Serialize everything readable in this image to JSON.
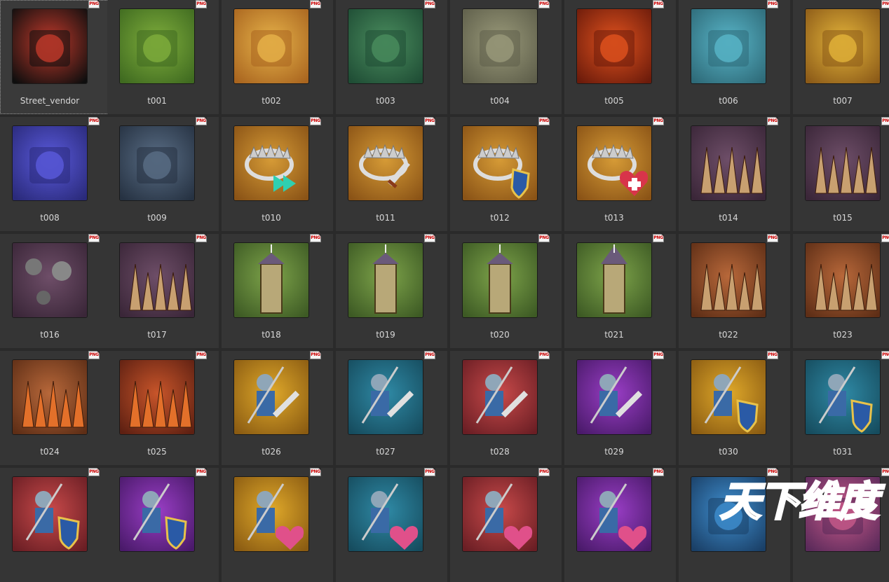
{
  "file_badge": "PNG",
  "items": [
    {
      "name": "Street_vendor",
      "icon": "street-vendor-icon",
      "bg": "#c0392b",
      "bg2": "#0e0e0e",
      "selected": true
    },
    {
      "name": "t001",
      "icon": "backpack-icon",
      "bg": "#7fae3c",
      "bg2": "#3f6a20"
    },
    {
      "name": "t002",
      "icon": "wheat-icon",
      "bg": "#e7b34a",
      "bg2": "#a9651f"
    },
    {
      "name": "t003",
      "icon": "lumber-axe-icon",
      "bg": "#4a8d5e",
      "bg2": "#1f4d35"
    },
    {
      "name": "t004",
      "icon": "stone-blocks-icon",
      "bg": "#9a9a7a",
      "bg2": "#5e5e4a"
    },
    {
      "name": "t005",
      "icon": "iron-lava-icon",
      "bg": "#e1521e",
      "bg2": "#6b1b0b"
    },
    {
      "name": "t006",
      "icon": "crane-construction-icon",
      "bg": "#59b6c9",
      "bg2": "#2e6a78"
    },
    {
      "name": "t007",
      "icon": "hammer-stone-icon",
      "bg": "#e4b43a",
      "bg2": "#8b5a18"
    },
    {
      "name": "t008",
      "icon": "crystal-miner-icon",
      "bg": "#5a5adc",
      "bg2": "#2a2a7a"
    },
    {
      "name": "t009",
      "icon": "storage-crate-icon",
      "bg": "#5a6e86",
      "bg2": "#263242"
    },
    {
      "name": "t010",
      "icon": "trap-speed-icon",
      "bg": "#d69b36",
      "bg2": "#8a5316"
    },
    {
      "name": "t011",
      "icon": "trap-sword-icon",
      "bg": "#d69b36",
      "bg2": "#8a5316"
    },
    {
      "name": "t012",
      "icon": "trap-shield-icon",
      "bg": "#d69b36",
      "bg2": "#8a5316"
    },
    {
      "name": "t013",
      "icon": "trap-heal-icon",
      "bg": "#d69b36",
      "bg2": "#8a5316"
    },
    {
      "name": "t014",
      "icon": "spiked-balls-icon",
      "bg": "#6e4e68",
      "bg2": "#3a2638"
    },
    {
      "name": "t015",
      "icon": "spiked-logs-icon",
      "bg": "#6e4e68",
      "bg2": "#3a2638"
    },
    {
      "name": "t016",
      "icon": "fire-caltrops-icon",
      "bg": "#6e4e68",
      "bg2": "#3a2638"
    },
    {
      "name": "t017",
      "icon": "fire-spiked-logs-icon",
      "bg": "#6e4e68",
      "bg2": "#3a2638"
    },
    {
      "name": "t018",
      "icon": "wooden-watchtower-icon",
      "bg": "#7ea44a",
      "bg2": "#3d5a24"
    },
    {
      "name": "t019",
      "icon": "reinforced-watchtower-icon",
      "bg": "#7ea44a",
      "bg2": "#3d5a24"
    },
    {
      "name": "t020",
      "icon": "stone-tower-icon",
      "bg": "#7ea44a",
      "bg2": "#3d5a24"
    },
    {
      "name": "t021",
      "icon": "spire-tower-icon",
      "bg": "#7ea44a",
      "bg2": "#3d5a24"
    },
    {
      "name": "t022",
      "icon": "wooden-stakes-icon",
      "bg": "#b8683a",
      "bg2": "#5e2e16"
    },
    {
      "name": "t023",
      "icon": "spike-barricade-icon",
      "bg": "#b8683a",
      "bg2": "#5e2e16"
    },
    {
      "name": "t024",
      "icon": "burning-stakes-icon",
      "bg": "#b8683a",
      "bg2": "#5e2e16"
    },
    {
      "name": "t025",
      "icon": "burning-spike-field-icon",
      "bg": "#c8552a",
      "bg2": "#5e2012"
    },
    {
      "name": "t026",
      "icon": "infantry-sword-icon",
      "bg": "#e0a92a",
      "bg2": "#8a5b12"
    },
    {
      "name": "t027",
      "icon": "cavalry-sword-icon",
      "bg": "#2f8aa6",
      "bg2": "#164c5e"
    },
    {
      "name": "t028",
      "icon": "archer-sword-icon",
      "bg": "#c94a4a",
      "bg2": "#6a1e24"
    },
    {
      "name": "t029",
      "icon": "siege-sword-icon",
      "bg": "#9a3ec6",
      "bg2": "#4a1a6a"
    },
    {
      "name": "t030",
      "icon": "infantry-shield-icon",
      "bg": "#e0a92a",
      "bg2": "#8a5b12"
    },
    {
      "name": "t031",
      "icon": "cavalry-shield-icon",
      "bg": "#2f8aa6",
      "bg2": "#164c5e"
    },
    {
      "name": "",
      "icon": "archer-shield-icon",
      "bg": "#c94a4a",
      "bg2": "#6a1e24"
    },
    {
      "name": "",
      "icon": "siege-shield-icon",
      "bg": "#9a3ec6",
      "bg2": "#4a1a6a"
    },
    {
      "name": "",
      "icon": "infantry-heal-icon",
      "bg": "#e0a92a",
      "bg2": "#8a5b12"
    },
    {
      "name": "",
      "icon": "cavalry-heal-icon",
      "bg": "#2f8aa6",
      "bg2": "#164c5e"
    },
    {
      "name": "",
      "icon": "archer-heal-icon",
      "bg": "#c94a4a",
      "bg2": "#6a1e24"
    },
    {
      "name": "",
      "icon": "siege-heal-icon",
      "bg": "#9a3ec6",
      "bg2": "#4a1a6a"
    },
    {
      "name": "",
      "icon": "city-banner-icon",
      "bg": "#3f8fd0",
      "bg2": "#1a3f66"
    },
    {
      "name": "",
      "icon": "character-portrait-icon",
      "bg": "#c85a8a",
      "bg2": "#5a2a5a"
    }
  ],
  "watermark": {
    "text": "天下维度"
  }
}
